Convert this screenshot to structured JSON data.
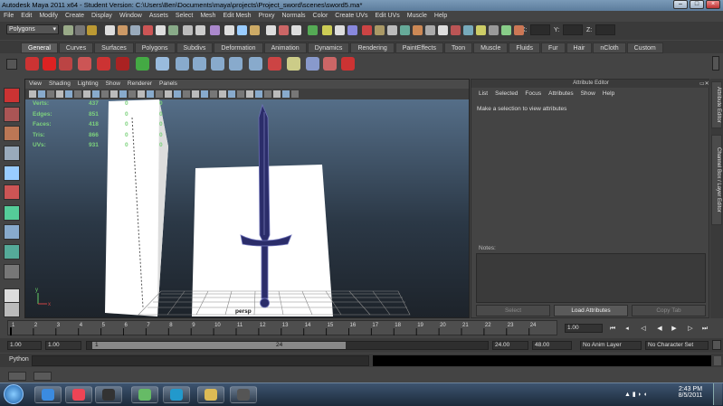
{
  "window": {
    "title": "Autodesk Maya 2011 x64 - Student Version: C:\\Users\\Ben\\Documents\\maya\\projects\\Project_sword\\scenes\\sword5.ma*",
    "min": "–",
    "max": "□",
    "close": "×"
  },
  "menubar": [
    "File",
    "Edit",
    "Modify",
    "Create",
    "Display",
    "Window",
    "Assets",
    "Select",
    "Mesh",
    "Edit Mesh",
    "Proxy",
    "Normals",
    "Color",
    "Create UVs",
    "Edit UVs",
    "Muscle",
    "Help"
  ],
  "status": {
    "mode": "Polygons",
    "x_label": "X:",
    "y_label": "Y:",
    "z_label": "Z:"
  },
  "shelf_tabs": [
    "General",
    "Curves",
    "Surfaces",
    "Polygons",
    "Subdivs",
    "Deformation",
    "Animation",
    "Dynamics",
    "Rendering",
    "PaintEffects",
    "Toon",
    "Muscle",
    "Fluids",
    "Fur",
    "Hair",
    "nCloth",
    "Custom"
  ],
  "viewport": {
    "menu": [
      "View",
      "Shading",
      "Lighting",
      "Show",
      "Renderer",
      "Panels"
    ],
    "hud": [
      {
        "label": "Verts:",
        "a": "437",
        "b": "0",
        "c": "0"
      },
      {
        "label": "Edges:",
        "a": "851",
        "b": "0",
        "c": "0"
      },
      {
        "label": "Faces:",
        "a": "418",
        "b": "0",
        "c": "0"
      },
      {
        "label": "Tris:",
        "a": "866",
        "b": "0",
        "c": "0"
      },
      {
        "label": "UVs:",
        "a": "931",
        "b": "0",
        "c": "0"
      }
    ],
    "camera": "persp",
    "axis_y": "y",
    "axis_x": "x"
  },
  "attribute_editor": {
    "header": "Attribute Editor",
    "menu": [
      "List",
      "Selected",
      "Focus",
      "Attributes",
      "Show",
      "Help"
    ],
    "message": "Make a selection to view attributes",
    "notes_label": "Notes:",
    "buttons": [
      "Select",
      "Load Attributes",
      "Copy Tab"
    ]
  },
  "side_tabs": [
    "Attribute Editor",
    "Channel Box / Layer Editor"
  ],
  "timeline": {
    "ticks": [
      "1",
      "2",
      "3",
      "4",
      "5",
      "6",
      "7",
      "8",
      "9",
      "10",
      "11",
      "12",
      "13",
      "14",
      "15",
      "16",
      "17",
      "18",
      "19",
      "20",
      "21",
      "22",
      "23",
      "24"
    ],
    "current": "1.00"
  },
  "range": {
    "start": "1.00",
    "play_start": "1.00",
    "slider_start": "1",
    "slider_end": "24",
    "play_end": "24.00",
    "end": "48.00",
    "anim_layer": "No Anim Layer",
    "character": "No Character Set"
  },
  "cmdline": {
    "label": "Python"
  },
  "taskbar": {
    "time": "2:43 PM",
    "date": "8/5/2011"
  }
}
